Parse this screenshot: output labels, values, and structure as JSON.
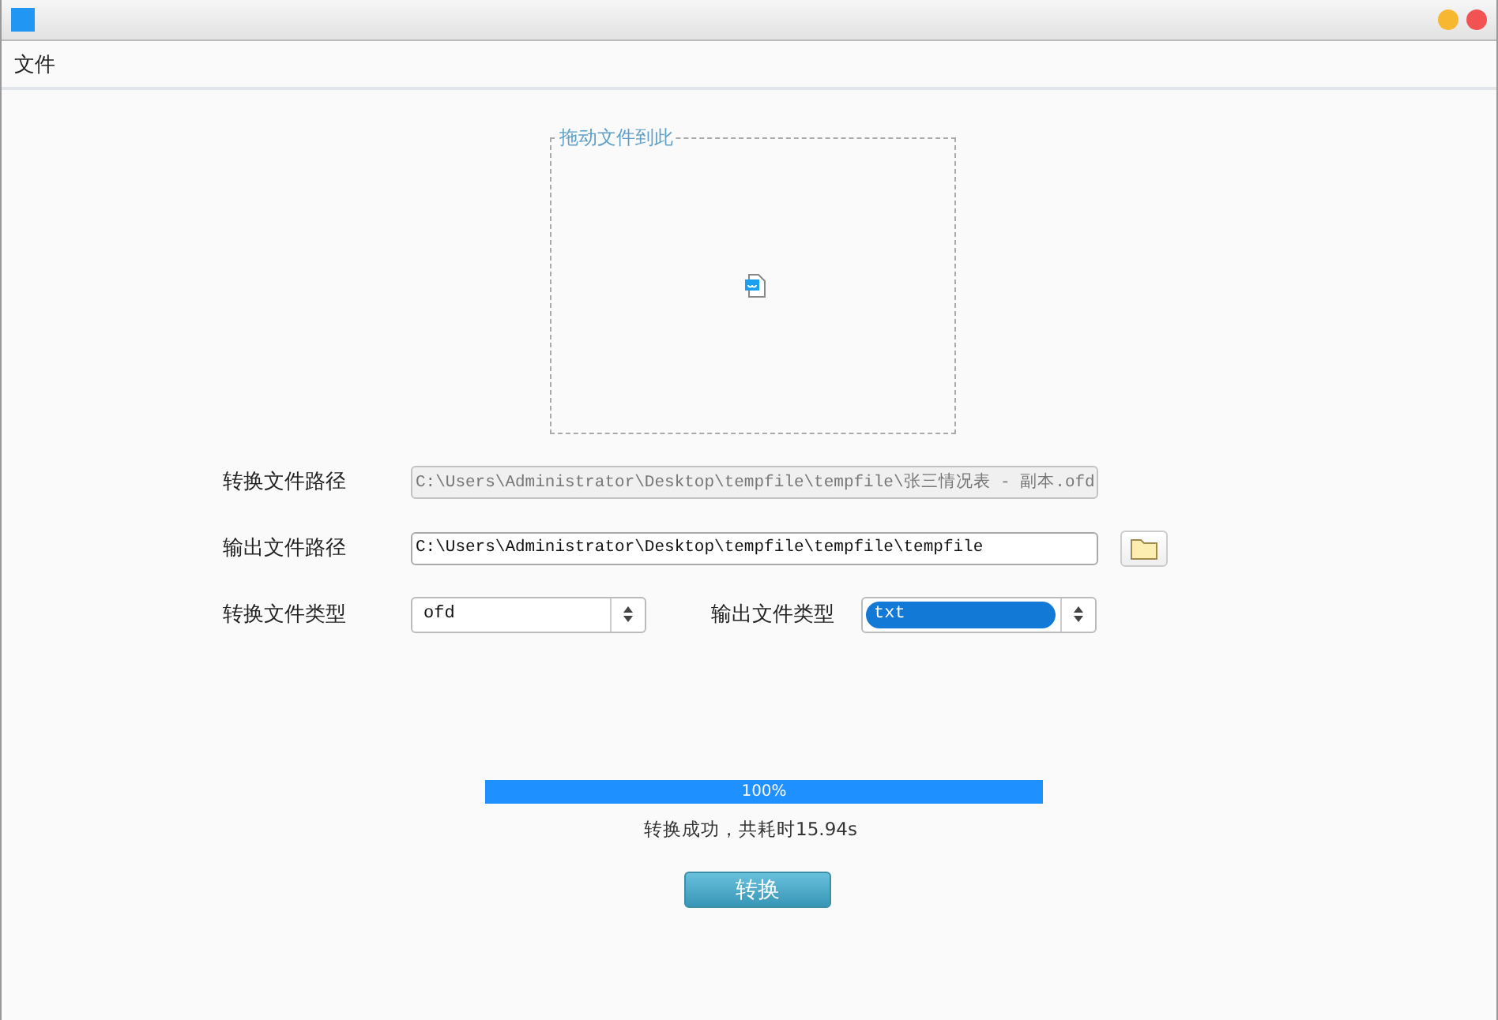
{
  "menu": [
    {
      "label": "文件"
    }
  ],
  "drop_zone": {
    "label": "拖动文件到此"
  },
  "paths": [
    {
      "label": "转换文件路径",
      "value": "C:\\Users\\Administrator\\Desktop\\tempfile\\tempfile\\张三情况表 - 副本.ofd",
      "disabled": true,
      "browse": false
    },
    {
      "label": "输出文件路径",
      "value": "C:\\Users\\Administrator\\Desktop\\tempfile\\tempfile\\tempfile",
      "disabled": false,
      "browse": true
    }
  ],
  "types": [
    {
      "label": "转换文件类型",
      "value": "ofd",
      "focused": false
    },
    {
      "label": "输出文件类型",
      "value": "txt",
      "focused": true
    }
  ],
  "progress": {
    "level": 1,
    "reading": "100%"
  },
  "status": "转换成功，共耗时15.94s",
  "button": "转换"
}
